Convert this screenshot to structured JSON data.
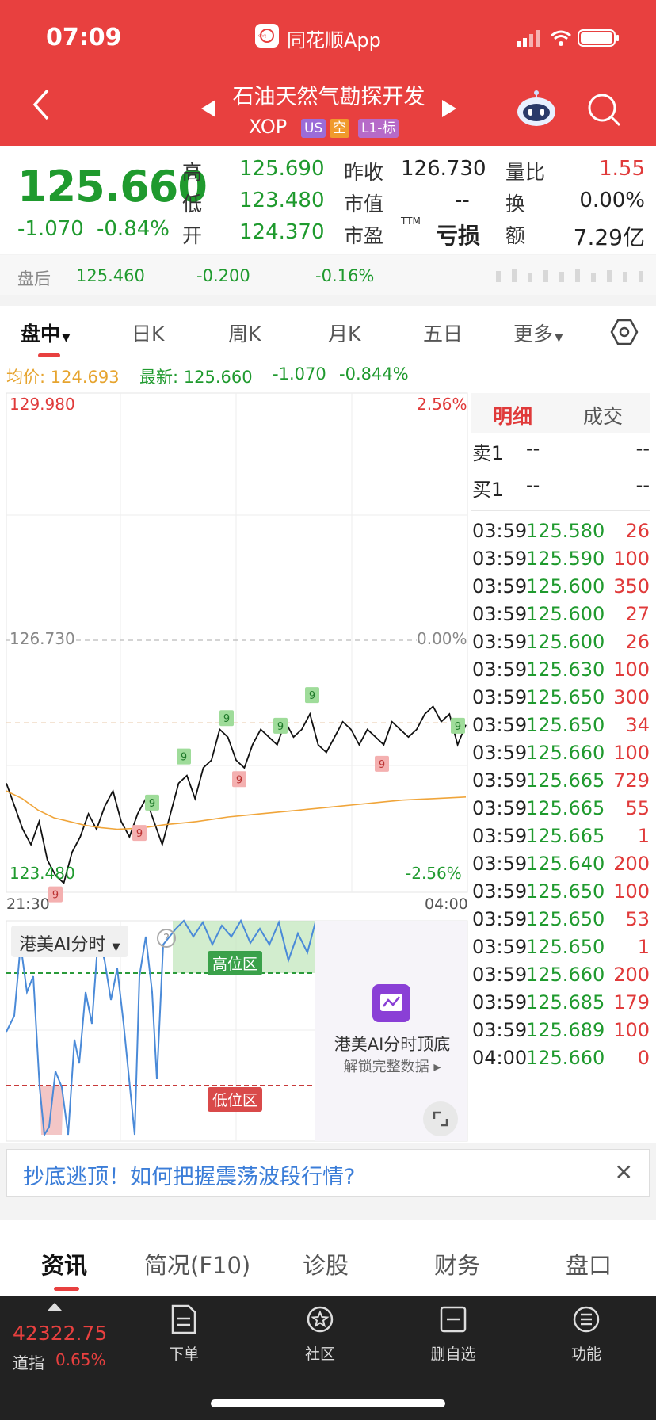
{
  "status_bar": {
    "time": "07:09",
    "app_name": "同花顺App"
  },
  "header": {
    "stock_name": "石油天然气勘探开发",
    "ticker": "XOP",
    "tags": [
      "US",
      "空",
      "L1-标"
    ],
    "colors": {
      "bg": "#e8403f",
      "tag_us": "#9b6cd8",
      "tag_short": "#f09a2c",
      "tag_l1": "#b66ac8"
    }
  },
  "quote": {
    "price": "125.660",
    "change": "-1.070",
    "change_pct": "-0.84%",
    "high_label": "高",
    "high": "125.690",
    "low_label": "低",
    "low": "123.480",
    "open_label": "开",
    "open": "124.370",
    "prev_close_label": "昨收",
    "prev_close": "126.730",
    "mkt_cap_label": "市值",
    "mkt_cap": "--",
    "pe_label": "市盈",
    "pe_sup": "TTM",
    "pe": "亏损",
    "vol_ratio_label": "量比",
    "vol_ratio": "1.55",
    "turnover_label": "换",
    "turnover": "0.00%",
    "amount_label": "额",
    "amount": "7.29亿"
  },
  "afterhours": {
    "label": "盘后",
    "price": "125.460",
    "change": "-0.200",
    "pct": "-0.16%"
  },
  "period_tabs": [
    "盘中",
    "日K",
    "周K",
    "月K",
    "五日",
    "更多"
  ],
  "info_bar": {
    "avg_label": "均价: 124.693",
    "latest_label": "最新: 125.660",
    "change": "-1.070",
    "pct": "-0.844%"
  },
  "chart_data": {
    "type": "line",
    "y_max_label": "129.980",
    "y_min_label": "123.480",
    "ref_label": "126.730",
    "ref_pct": "0.00%",
    "top_pct": "2.56%",
    "bottom_pct": "-2.56%",
    "x_start": "21:30",
    "x_end": "04:00",
    "ylim": [
      123.48,
      129.98
    ],
    "series": [
      {
        "values": [
          124.9,
          124.6,
          124.3,
          124.1,
          124.4,
          123.9,
          123.7,
          123.6,
          124.0,
          124.2,
          124.5,
          124.3,
          124.6,
          124.8,
          124.4,
          124.2,
          124.5,
          124.7,
          124.4,
          124.1,
          124.5,
          124.9,
          125.0,
          124.7,
          125.1,
          125.2,
          125.6,
          125.5,
          125.2,
          125.1,
          125.4,
          125.6,
          125.5,
          125.4,
          125.7,
          125.5,
          125.6,
          125.8,
          125.4,
          125.3,
          125.5,
          125.7,
          125.6,
          125.4,
          125.6,
          125.5,
          125.4,
          125.7,
          125.6,
          125.5,
          125.6,
          125.8,
          125.9,
          125.7,
          125.8,
          125.4,
          125.66
        ],
        "color": "#111111"
      },
      {
        "values": [
          124.8,
          124.7,
          124.55,
          124.45,
          124.4,
          124.35,
          124.32,
          124.3,
          124.31,
          124.33,
          124.36,
          124.38,
          124.4,
          124.43,
          124.46,
          124.48,
          124.5,
          124.52,
          124.54,
          124.56,
          124.58,
          124.6,
          124.62,
          124.64,
          124.66,
          124.68,
          124.69,
          124.7,
          124.71,
          124.72
        ],
        "color": "#f0a53a"
      }
    ],
    "signals": [
      "9",
      "9",
      "9",
      "9",
      "9",
      "9",
      "9",
      "9",
      "9",
      "9"
    ]
  },
  "indicator": {
    "title": "港美AI分时",
    "high_zone": "高位区",
    "low_zone": "低位区",
    "lock_title": "港美AI分时顶底",
    "lock_sub": "解锁完整数据"
  },
  "detail": {
    "tab_detail": "明细",
    "tab_trade": "成交",
    "sell1_label": "卖1",
    "sell1_price": "--",
    "sell1_vol": "--",
    "buy1_label": "买1",
    "buy1_price": "--",
    "buy1_vol": "--",
    "rows": [
      {
        "time": "03:59",
        "price": "125.580",
        "vol": "26"
      },
      {
        "time": "03:59",
        "price": "125.590",
        "vol": "100"
      },
      {
        "time": "03:59",
        "price": "125.600",
        "vol": "350"
      },
      {
        "time": "03:59",
        "price": "125.600",
        "vol": "27"
      },
      {
        "time": "03:59",
        "price": "125.600",
        "vol": "26"
      },
      {
        "time": "03:59",
        "price": "125.630",
        "vol": "100"
      },
      {
        "time": "03:59",
        "price": "125.650",
        "vol": "300"
      },
      {
        "time": "03:59",
        "price": "125.650",
        "vol": "34"
      },
      {
        "time": "03:59",
        "price": "125.660",
        "vol": "100"
      },
      {
        "time": "03:59",
        "price": "125.665",
        "vol": "729"
      },
      {
        "time": "03:59",
        "price": "125.665",
        "vol": "55"
      },
      {
        "time": "03:59",
        "price": "125.665",
        "vol": "1"
      },
      {
        "time": "03:59",
        "price": "125.640",
        "vol": "200"
      },
      {
        "time": "03:59",
        "price": "125.650",
        "vol": "100"
      },
      {
        "time": "03:59",
        "price": "125.650",
        "vol": "53"
      },
      {
        "time": "03:59",
        "price": "125.650",
        "vol": "1"
      },
      {
        "time": "03:59",
        "price": "125.660",
        "vol": "200"
      },
      {
        "time": "03:59",
        "price": "125.685",
        "vol": "179"
      },
      {
        "time": "03:59",
        "price": "125.689",
        "vol": "100"
      },
      {
        "time": "04:00",
        "price": "125.660",
        "vol": "0"
      }
    ]
  },
  "banner": {
    "text": "抄底逃顶！如何把握震荡波段行情?"
  },
  "bottom_tabs": [
    "资讯",
    "简况(F10)",
    "诊股",
    "财务",
    "盘口"
  ],
  "toolbar": {
    "index_value": "42322.75",
    "index_name": "道指",
    "index_pct": "0.65%",
    "items": [
      "下单",
      "社区",
      "删自选",
      "功能"
    ]
  }
}
